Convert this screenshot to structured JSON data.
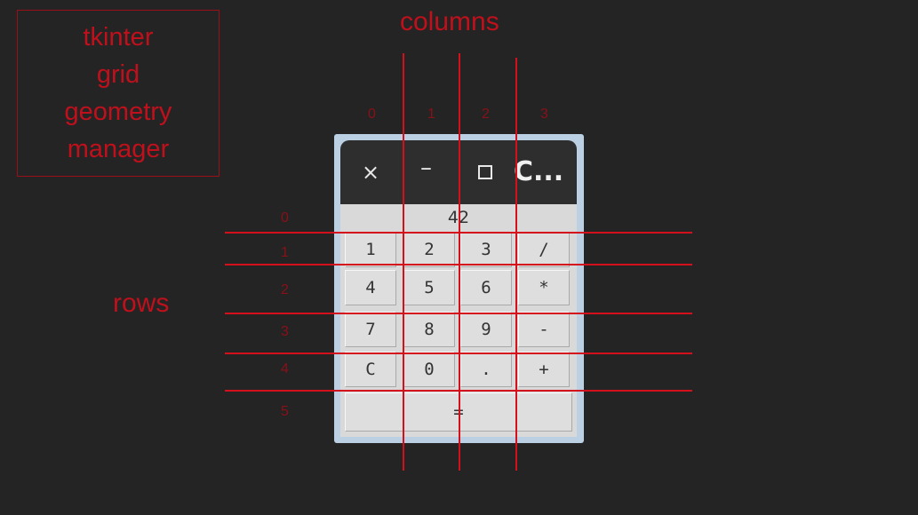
{
  "annotations": {
    "title_lines": [
      "tkinter",
      "grid",
      "geometry",
      "manager"
    ],
    "columns_label": "columns",
    "rows_label": "rows",
    "column_indices": [
      "0",
      "1",
      "2",
      "3"
    ],
    "row_indices": [
      "0",
      "1",
      "2",
      "3",
      "4",
      "5"
    ]
  },
  "window": {
    "title": "C...",
    "close_glyph": "×",
    "minimize_glyph": "–"
  },
  "calculator": {
    "display_value": "42",
    "buttons": [
      [
        "1",
        "2",
        "3",
        "/"
      ],
      [
        "4",
        "5",
        "6",
        "*"
      ],
      [
        "7",
        "8",
        "9",
        "-"
      ],
      [
        "C",
        "0",
        ".",
        "+"
      ]
    ],
    "equals_label": "="
  },
  "colors": {
    "background": "#242424",
    "annotation_red": "#c0101c",
    "window_frame": "#bcd0e4",
    "titlebar": "#2e2e2e",
    "button_face": "#dedede"
  }
}
